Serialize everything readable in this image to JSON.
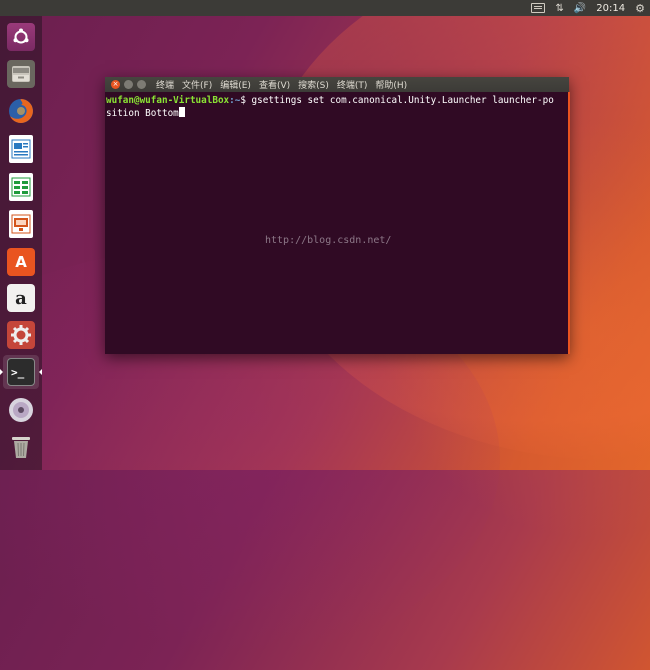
{
  "panel": {
    "clock": "20:14",
    "icons": [
      "keyboard-icon",
      "network-icon",
      "volume-icon",
      "settings-gear-icon"
    ]
  },
  "launcher": {
    "items": [
      {
        "name": "dash-home",
        "icon": "ubuntu-logo-icon"
      },
      {
        "name": "files",
        "icon": "file-cabinet-icon"
      },
      {
        "name": "firefox",
        "icon": "firefox-icon"
      },
      {
        "name": "libreoffice-writer",
        "icon": "writer-icon"
      },
      {
        "name": "libreoffice-calc",
        "icon": "calc-icon"
      },
      {
        "name": "libreoffice-impress",
        "icon": "impress-icon"
      },
      {
        "name": "software-center",
        "icon": "shopping-bag-icon",
        "glyph": "A"
      },
      {
        "name": "amazon",
        "icon": "amazon-icon",
        "glyph": "a"
      },
      {
        "name": "system-settings",
        "icon": "tools-gear-icon"
      },
      {
        "name": "terminal",
        "icon": "terminal-icon",
        "glyph": ">_"
      },
      {
        "name": "dvd",
        "icon": "disc-icon"
      },
      {
        "name": "trash",
        "icon": "trash-icon"
      }
    ]
  },
  "terminal": {
    "menu": [
      "终端",
      "文件(F)",
      "编辑(E)",
      "查看(V)",
      "搜索(S)",
      "终端(T)",
      "帮助(H)"
    ],
    "prompt_user": "wufan@wufan-VirtualBox",
    "prompt_path": ":~",
    "prompt_symbol": "$ ",
    "command_line1": "gsettings set com.canonical.Unity.Launcher launcher-po",
    "command_line2": "sition Bottom"
  },
  "watermark": "http://blog.csdn.net/"
}
